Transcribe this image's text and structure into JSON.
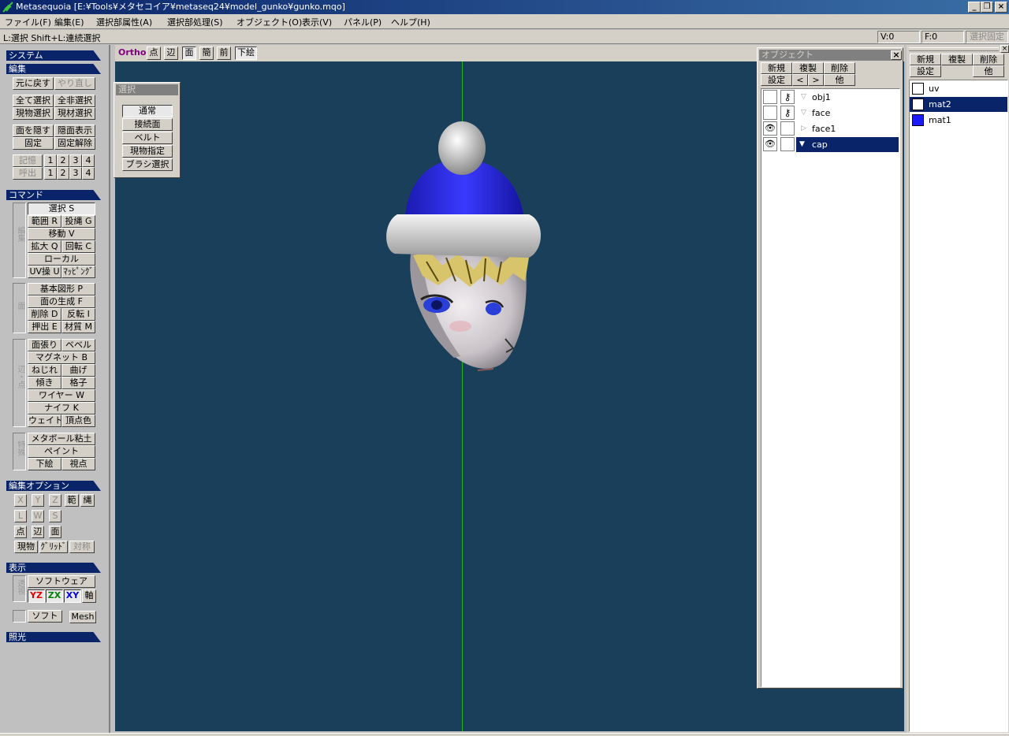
{
  "window": {
    "title": "Metasequoia [E:¥Tools¥メタセコイア¥metaseq24¥model_gunko¥gunko.mqo]"
  },
  "menu": [
    "ファイル(F)",
    "編集(E)",
    "選択部属性(A)",
    "選択部処理(S)",
    "オブジェクト(O)",
    "表示(V)",
    "パネル(P)",
    "ヘルプ(H)"
  ],
  "status": {
    "hint": "L:選択  Shift+L:連続選択",
    "v": "V:0",
    "f": "F:0",
    "lock": "選択固定"
  },
  "left": {
    "system": "システム",
    "edit": "編集",
    "undo": "元に戻す",
    "redo": "やり直し",
    "select_all": "全て選択",
    "deselect_all": "全非選択",
    "obj_select": "現物選択",
    "mat_select": "現材選択",
    "hide_face": "面を隠す",
    "show_hidden": "隠面表示",
    "fix": "固定",
    "unfix": "固定解除",
    "memory": "記憶",
    "recall": "呼出",
    "nums": [
      "1",
      "2",
      "3",
      "4"
    ],
    "command": "コマンド",
    "edit_label": "編集",
    "select": "選択 S",
    "range": "範囲 R",
    "lasso": "投縄 G",
    "move": "移動 V",
    "scale": "拡大 Q",
    "rotate": "回転 C",
    "local": "ローカル",
    "uv": "UV操 U",
    "mapping": "ﾏｯﾋﾟﾝｸﾞ",
    "face_label": "面",
    "primitive": "基本図形 P",
    "create_face": "面の生成 F",
    "delete": "削除 D",
    "flip": "反転 I",
    "extrude": "押出 E",
    "material": "材質 M",
    "edge_label": "辺・点",
    "stretch": "面張り",
    "bevel": "ベベル",
    "magnet": "マグネット B",
    "twist": "ねじれ",
    "bend": "曲げ",
    "tilt": "傾き",
    "lattice": "格子",
    "wire": "ワイヤー W",
    "knife": "ナイフ K",
    "weight": "ウェイト",
    "vertex_color": "頂点色",
    "special_label": "特殊",
    "metaball": "メタボール粘土",
    "paint": "ペイント",
    "underlay": "下絵",
    "viewpoint": "視点",
    "edit_options": "編集オプション",
    "ax_x": "X",
    "ax_y": "Y",
    "ax_z": "Z",
    "opt_range": "範",
    "opt_lasso": "縄",
    "opt_l": "L",
    "opt_w": "W",
    "opt_s": "S",
    "opt_point": "点",
    "opt_edge": "辺",
    "opt_face": "面",
    "opt_current": "現物",
    "opt_grid": "ｸﾞﾘｯﾄﾞ",
    "opt_sym": "対称",
    "display": "表示",
    "render_label": "透視",
    "software": "ソフトウェア",
    "yz": "YZ",
    "zx": "ZX",
    "xy": "XY",
    "axis": "軸",
    "soft": "ソフト",
    "mesh": "Mesh",
    "lighting": "照光"
  },
  "viewbar": {
    "ortho": "Ortho",
    "point": "点",
    "edge": "辺",
    "face": "面",
    "simple": "簡",
    "front": "前",
    "underlay": "下絵"
  },
  "select_panel": {
    "title": "選択",
    "items": [
      "通常",
      "接続面",
      "ベルト",
      "現物指定",
      "ブラシ選択"
    ]
  },
  "object_panel": {
    "title": "オブジェクト",
    "new": "新規",
    "copy": "複製",
    "delete": "削除",
    "settings": "設定",
    "prev": "<",
    "next": ">",
    "other": "他",
    "objects": [
      {
        "name": "obj1",
        "visible": false,
        "locked": true,
        "selected": false
      },
      {
        "name": "face",
        "visible": false,
        "locked": true,
        "selected": false
      },
      {
        "name": "face1",
        "visible": true,
        "locked": false,
        "selected": false
      },
      {
        "name": "cap",
        "visible": true,
        "locked": false,
        "selected": true
      }
    ]
  },
  "material_panel": {
    "new": "新規",
    "copy": "複製",
    "delete": "削除",
    "settings": "設定",
    "other": "他",
    "materials": [
      {
        "name": "uv",
        "color": "#ffffff",
        "selected": false
      },
      {
        "name": "mat2",
        "color": "#ffffff",
        "selected": true
      },
      {
        "name": "mat1",
        "color": "#1a1aff",
        "selected": false
      }
    ]
  },
  "colors": {
    "viewport_bg": "#1a3f5a",
    "header": "#0a246a",
    "axis_green": "#1fb31f",
    "cap_blue": "#2424e0"
  }
}
